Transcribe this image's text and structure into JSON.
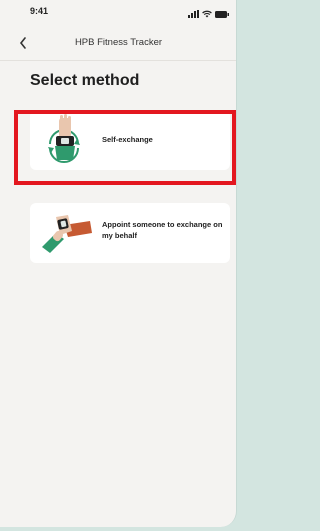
{
  "status_bar": {
    "time": "9:41"
  },
  "header": {
    "title": "HPB Fitness Tracker"
  },
  "page": {
    "title": "Select method"
  },
  "methods": [
    {
      "label": "Self-exchange",
      "icon": "self-exchange-illustration"
    },
    {
      "label": "Appoint someone to exchange on my behalf",
      "icon": "handover-illustration"
    }
  ],
  "colors": {
    "highlight": "#e3171f",
    "background": "#f4f3f1",
    "card": "#ffffff",
    "accent_green": "#2f9a6d",
    "accent_orange": "#c65a32"
  }
}
